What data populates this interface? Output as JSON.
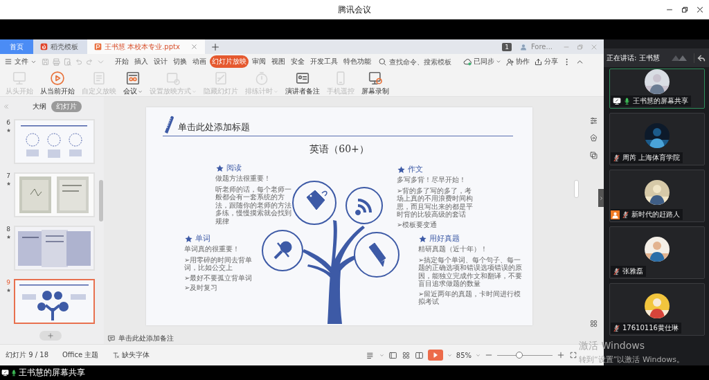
{
  "app_title": "腾讯会议",
  "wps": {
    "tabs": [
      {
        "label": "首页",
        "kind": "home",
        "selected": false
      },
      {
        "label": "稻壳模板",
        "kind": "docer",
        "selected": false
      },
      {
        "label": "王书慧 本校本专业.pptx",
        "kind": "doc",
        "selected": true
      }
    ],
    "account": {
      "badge": "1",
      "name": "Fore..."
    },
    "file_menu": "文件",
    "menu_tabs": [
      {
        "label": "开始",
        "selected": false
      },
      {
        "label": "插入",
        "selected": false
      },
      {
        "label": "设计",
        "selected": false
      },
      {
        "label": "切换",
        "selected": false
      },
      {
        "label": "动画",
        "selected": false
      },
      {
        "label": "幻灯片放映",
        "selected": true
      },
      {
        "label": "审阅",
        "selected": false
      },
      {
        "label": "视图",
        "selected": false
      },
      {
        "label": "安全",
        "selected": false
      },
      {
        "label": "开发工具",
        "selected": false
      },
      {
        "label": "特色功能",
        "selected": false
      }
    ],
    "search": {
      "placeholder": "查找命令、搜索模板"
    },
    "actions": [
      "已同步",
      "协作",
      "分享"
    ],
    "ribbon": [
      {
        "label": "从头开始",
        "disabled": true,
        "dropdown": false
      },
      {
        "label": "从当前开始",
        "disabled": false,
        "dropdown": false
      },
      {
        "label": "自定义放映",
        "disabled": true,
        "dropdown": false
      },
      {
        "label": "会议",
        "disabled": false,
        "dropdown": true
      },
      {
        "label": "设置放映方式",
        "disabled": true,
        "dropdown": true
      },
      {
        "label": "隐藏幻灯片",
        "disabled": true,
        "dropdown": false
      },
      {
        "label": "排练计时",
        "disabled": true,
        "dropdown": true
      },
      {
        "label": "演讲者备注",
        "disabled": false,
        "dropdown": false
      },
      {
        "label": "手机遥控",
        "disabled": true,
        "dropdown": false
      },
      {
        "label": "屏幕录制",
        "disabled": false,
        "dropdown": false
      }
    ],
    "panel_tabs": [
      {
        "label": "大纲",
        "selected": false
      },
      {
        "label": "幻灯片",
        "selected": true
      }
    ],
    "thumbnails": [
      {
        "number": "6",
        "selected": false
      },
      {
        "number": "7",
        "selected": false
      },
      {
        "number": "8",
        "selected": false
      },
      {
        "number": "9",
        "selected": true
      }
    ],
    "slide": {
      "title": "单击此处添加标题",
      "heading": "英语（60+）",
      "sections": [
        {
          "title": "阅读",
          "subtitle": "做题方法很重要！",
          "points": [
            "听老师的话，每个老师一般都会有一套系统的方法，跟随你的老师的方法多练，慢慢摸索就会找到规律"
          ]
        },
        {
          "title": "作文",
          "subtitle": "多写多背！尽早开始！",
          "points": [
            "➢背的多了写的多了，考场上真的不用浪费时间构思，而且写出来的都是平时背的比较高级的套话",
            "➢模板要变通"
          ]
        },
        {
          "title": "单词",
          "subtitle": "单词真的很重要！",
          "points": [
            "➢用零碎的时间去背单词，比如公交上",
            "➢最好不要孤立背单词",
            "➢及时复习"
          ]
        },
        {
          "title": "用好真题",
          "subtitle": "精研真题（近十年）！",
          "points": [
            "➢搞定每个单词、每个句子、每一题的正确选项和错误选项错误的原因，能独立完成作文和翻译，不要盲目追求做题的数量",
            "➢留近两年的真题，卡时间进行模拟考试"
          ]
        }
      ]
    },
    "notes_placeholder": "单击此处添加备注",
    "status_bar": {
      "slide_position": "幻灯片 9 / 18",
      "theme": "Office 主题",
      "font_notice": "缺失字体",
      "zoom": "85%",
      "zoom_slider": {
        "level": 0.4
      }
    }
  },
  "meeting": {
    "speaking": "正在讲话: 王书慧",
    "participants": [
      {
        "name": "王书慧的屏幕共享",
        "kind": "screen",
        "mic_on": true,
        "selected": true
      },
      {
        "name": "周芮 上海体育学院",
        "kind": "plain",
        "mic_on": false,
        "selected": false
      },
      {
        "name": "新时代的赶路人",
        "kind": "person",
        "mic_on": false,
        "selected": false
      },
      {
        "name": "张雅磊",
        "kind": "plain",
        "mic_on": false,
        "selected": false
      },
      {
        "name": "17610116黄仕琳",
        "kind": "plain",
        "mic_on": false,
        "selected": false
      }
    ]
  },
  "share_bar": {
    "label": "王书慧的屏幕共享"
  },
  "activation": {
    "title": "激活 Windows",
    "note": "转到“设置”以激活 Windows。"
  }
}
